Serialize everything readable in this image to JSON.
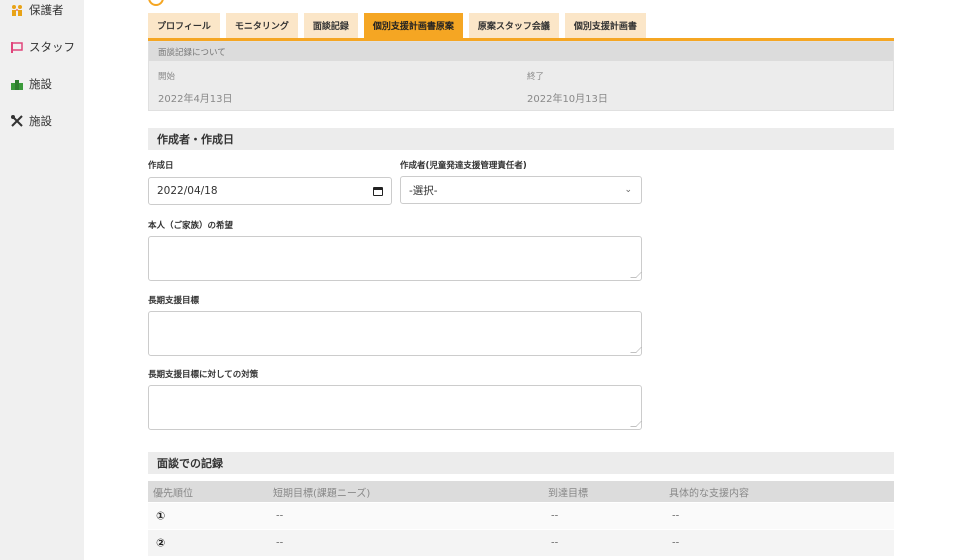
{
  "sidebar": {
    "items": [
      {
        "label": "保護者",
        "icon": "guardians-icon"
      },
      {
        "label": "スタッフ",
        "icon": "staff-icon"
      },
      {
        "label": "施設",
        "icon": "facility-icon"
      },
      {
        "label": "施設",
        "icon": "tools-icon"
      }
    ]
  },
  "tabs": [
    {
      "label": "プロフィール",
      "active": false
    },
    {
      "label": "モニタリング",
      "active": false
    },
    {
      "label": "面談記録",
      "active": false
    },
    {
      "label": "個別支援計画書原案",
      "active": true
    },
    {
      "label": "原案スタッフ会議",
      "active": false
    },
    {
      "label": "個別支援計画書",
      "active": false
    }
  ],
  "interview_info": {
    "heading": "面談記録について",
    "start_label": "開始",
    "start_value": "2022年4月13日",
    "end_label": "終了",
    "end_value": "2022年10月13日"
  },
  "author_section": {
    "title": "作成者・作成日",
    "date_label": "作成日",
    "date_value": "2022/04/18",
    "author_label": "作成者(児童発達支援管理責任者)",
    "author_value": "-選択-",
    "wish_label": "本人（ご家族）の希望",
    "long_goal_label": "長期支援目標",
    "long_measure_label": "長期支援目標に対しての対策"
  },
  "records": {
    "title": "面談での記録",
    "headers": [
      "優先順位",
      "短期目標(課題ニーズ)",
      "到達目標",
      "具体的な支援内容"
    ],
    "rows": [
      {
        "priority": "①",
        "short_goal": "--",
        "target": "--",
        "support": "--"
      },
      {
        "priority": "②",
        "short_goal": "--",
        "target": "--",
        "support": "--"
      }
    ]
  },
  "colors": {
    "accent": "#f5a623",
    "tab_inactive": "#fbe6c8",
    "sidebar_bg": "#f0f0f0"
  }
}
